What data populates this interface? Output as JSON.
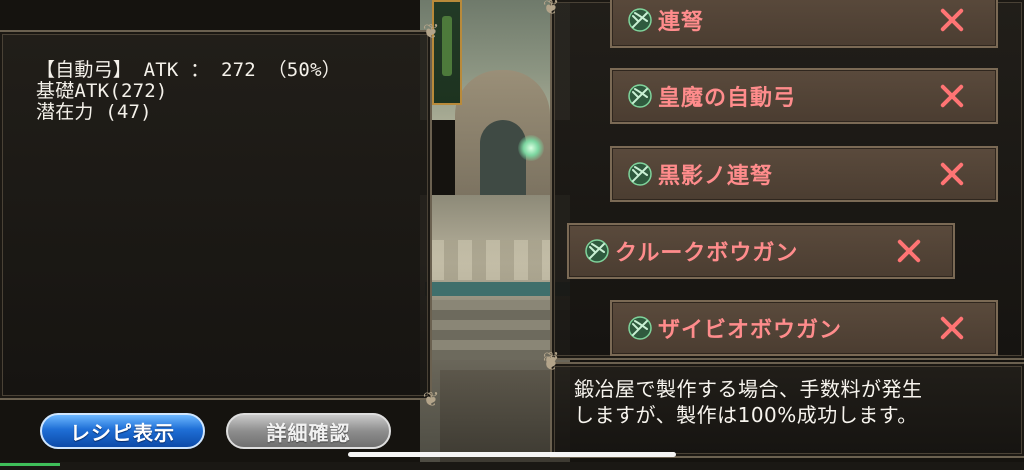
{
  "stats": {
    "line1": "【自動弓】 ATK ： 272 （50%）",
    "line2": "基礎ATK(272)",
    "line3": "潜在力 (47)"
  },
  "recipe_list": {
    "items": [
      {
        "label": "連弩",
        "icon": "crossbow-icon"
      },
      {
        "label": "皇魔の自動弓",
        "icon": "crossbow-icon"
      },
      {
        "label": "黒影ノ連弩",
        "icon": "crossbow-icon"
      },
      {
        "label": "クルークボウガン",
        "icon": "crossbow-icon",
        "selected": true
      },
      {
        "label": "ザイビオボウガン",
        "icon": "crossbow-icon"
      }
    ],
    "close_icon": "close-icon"
  },
  "message": {
    "line1": "鍛冶屋で製作する場合、手数料が発生",
    "line2": "しますが、製作は100%成功します。"
  },
  "buttons": {
    "recipe_label": "レシピ表示",
    "detail_label": "詳細確認"
  },
  "colors": {
    "item_label": "#ff8c8c",
    "close_x": "#ff7474",
    "recipe_button": "#1f6fd6",
    "detail_button": "#8e8e8e"
  }
}
